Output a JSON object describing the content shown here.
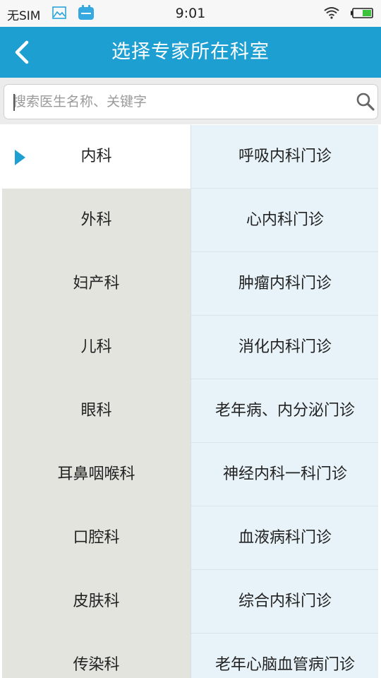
{
  "status_bar": {
    "carrier": "无SIM",
    "time": "9:01",
    "icons": [
      "gallery-icon",
      "app-icon",
      "wifi-icon",
      "battery-icon"
    ]
  },
  "header": {
    "title": "选择专家所在科室",
    "back_icon": "chevron-left-icon"
  },
  "search": {
    "placeholder": "搜索医生名称、关键字",
    "value": "",
    "icon": "search-icon"
  },
  "departments": [
    {
      "label": "内科",
      "selected": true
    },
    {
      "label": "外科",
      "selected": false
    },
    {
      "label": "妇产科",
      "selected": false
    },
    {
      "label": "儿科",
      "selected": false
    },
    {
      "label": "眼科",
      "selected": false
    },
    {
      "label": "耳鼻咽喉科",
      "selected": false
    },
    {
      "label": "口腔科",
      "selected": false
    },
    {
      "label": "皮肤科",
      "selected": false
    },
    {
      "label": "传染科",
      "selected": false
    }
  ],
  "clinics": [
    {
      "label": "呼吸内科门诊"
    },
    {
      "label": "心内科门诊"
    },
    {
      "label": "肿瘤内科门诊"
    },
    {
      "label": "消化内科门诊"
    },
    {
      "label": "老年病、内分泌门诊"
    },
    {
      "label": "神经内科一科门诊"
    },
    {
      "label": "血液病科门诊"
    },
    {
      "label": "综合内科门诊"
    },
    {
      "label": "老年心脑血管病门诊"
    }
  ],
  "colors": {
    "accent": "#1d9fd2",
    "selected_marker": "#1d9fd2",
    "dept_bg": "#e4e4df",
    "clinic_bg": "#e8f3f9"
  }
}
